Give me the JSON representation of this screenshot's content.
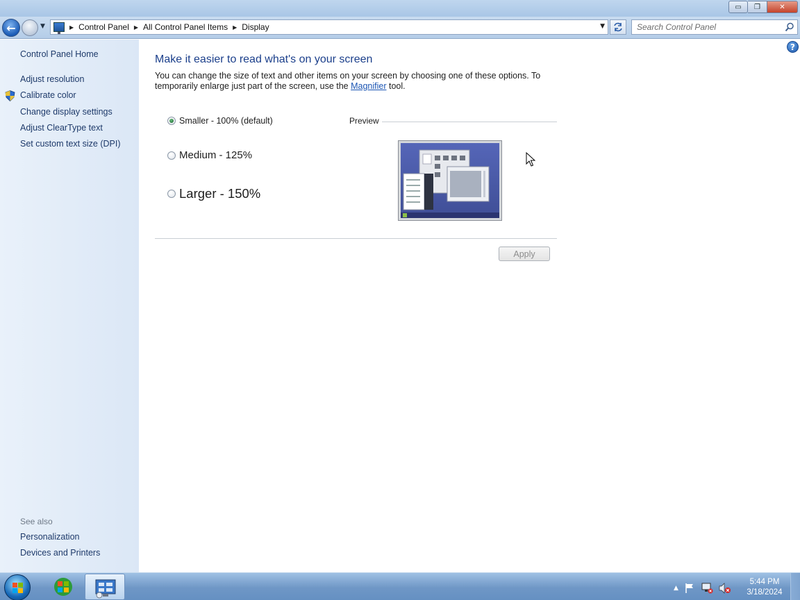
{
  "window": {
    "buttons": {
      "minimize": "▭",
      "restore": "❐",
      "close": "✕"
    }
  },
  "address_bar": {
    "breadcrumbs": [
      "Control Panel",
      "All Control Panel Items",
      "Display"
    ],
    "search_placeholder": "Search Control Panel"
  },
  "sidebar": {
    "home": "Control Panel Home",
    "links": [
      "Adjust resolution",
      "Calibrate color",
      "Change display settings",
      "Adjust ClearType text",
      "Set custom text size (DPI)"
    ],
    "see_also_title": "See also",
    "see_also": [
      "Personalization",
      "Devices and Printers"
    ]
  },
  "main": {
    "title": "Make it easier to read what's on your screen",
    "description_part1": "You can change the size of text and other items on your screen by choosing one of these options. To temporarily enlarge just part of the screen, use the ",
    "description_link": "Magnifier",
    "description_part2": " tool.",
    "options": [
      {
        "label": "Smaller - 100% (default)",
        "selected": true
      },
      {
        "label": "Medium - 125%",
        "selected": false
      },
      {
        "label": "Larger - 150%",
        "selected": false
      }
    ],
    "preview_label": "Preview",
    "apply_label": "Apply"
  },
  "help": {
    "glyph": "?"
  },
  "taskbar": {
    "time": "5:44 PM",
    "date": "3/18/2024"
  },
  "colors": {
    "accent_title": "#1b3f8b",
    "link": "#1e3a6a",
    "sidebar_bg": "#e3edf8",
    "taskbar": "#6f97c6"
  }
}
